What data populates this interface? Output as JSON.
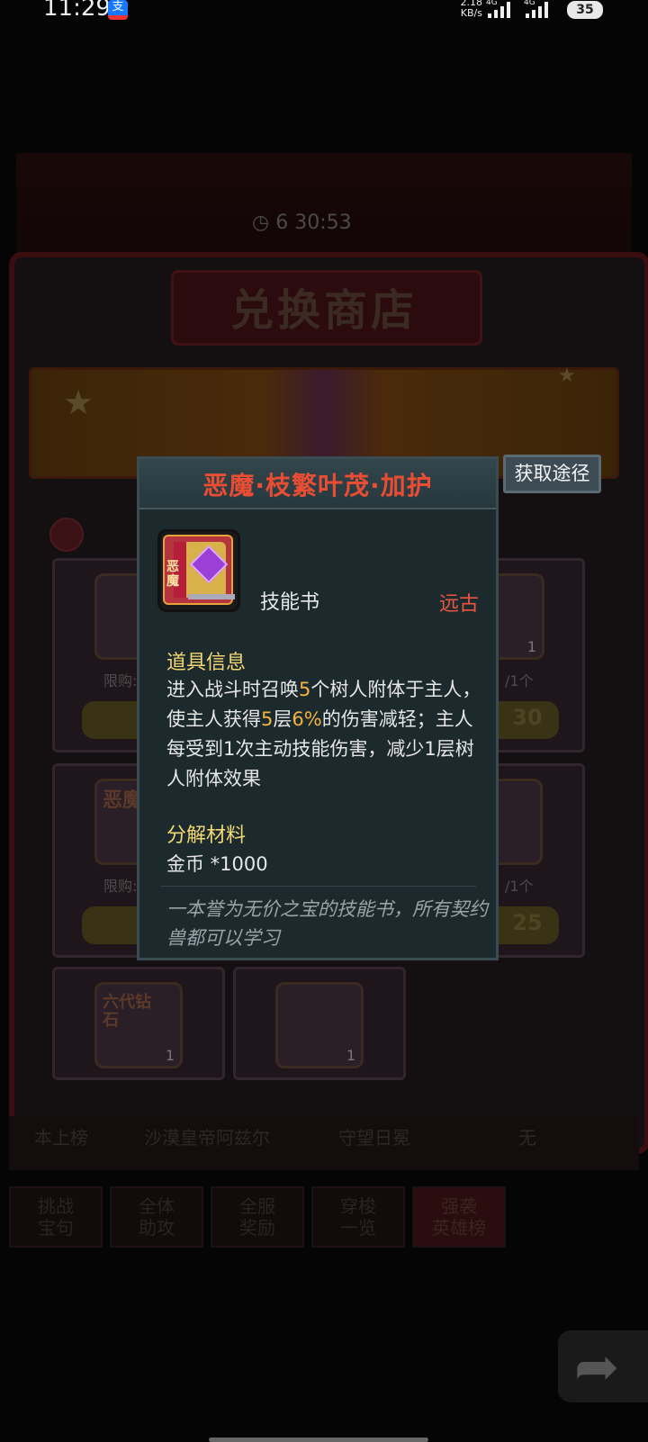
{
  "status_bar": {
    "time": "11:29",
    "app_icon": "alipay-icon",
    "net_speed_value": "2.18",
    "net_speed_unit": "KB/s",
    "network_1": "4G",
    "network_2": "4G",
    "battery": "35"
  },
  "background": {
    "banner_timer": "6 30:53",
    "shop_title": "兑换商店",
    "cards": [
      {
        "limit": "限购:",
        "count": "",
        "price": ""
      },
      {
        "limit": "/1个",
        "count": "1",
        "price": "30"
      },
      {
        "limit": "限购:",
        "count": "",
        "price": "",
        "icon_text": "恶魔"
      },
      {
        "limit": "/1个",
        "count": "",
        "price": "25"
      },
      {
        "count": "1",
        "icon_text": "六代钻石"
      },
      {
        "count": "1"
      }
    ],
    "footer_items": [
      "本上榜",
      "沙漠皇帝阿兹尔",
      "守望日冕",
      "无"
    ],
    "tabs": [
      "挑战\n宝句",
      "全体\n助攻",
      "全服\n奖励",
      "穿梭\n一览",
      "强袭\n英雄榜"
    ]
  },
  "popup": {
    "title": "恶魔·枝繁叶茂·加护",
    "item_icon_text": "恶魔",
    "item_type": "技能书",
    "rarity": "远古",
    "info_title": "道具信息",
    "desc_parts": {
      "p1": "进入战斗时召唤",
      "n1": "5",
      "p2": "个树人附体于主人，使主人获得",
      "n2": "5",
      "p3": "层",
      "n3": "6%",
      "p4": "的伤害减轻；主人每受到1次主动技能伤害，减少1层树人附体效果"
    },
    "material_title": "分解材料",
    "material": "金币 *1000",
    "flavor": "一本誉为无价之宝的技能书，所有契约兽都可以学习"
  },
  "get_button": "获取途径",
  "colors": {
    "title_red": "#ea4d33",
    "highlight": "#f2b440",
    "section_gold": "#f3d873",
    "popup_bg": "#1c2a2e"
  }
}
